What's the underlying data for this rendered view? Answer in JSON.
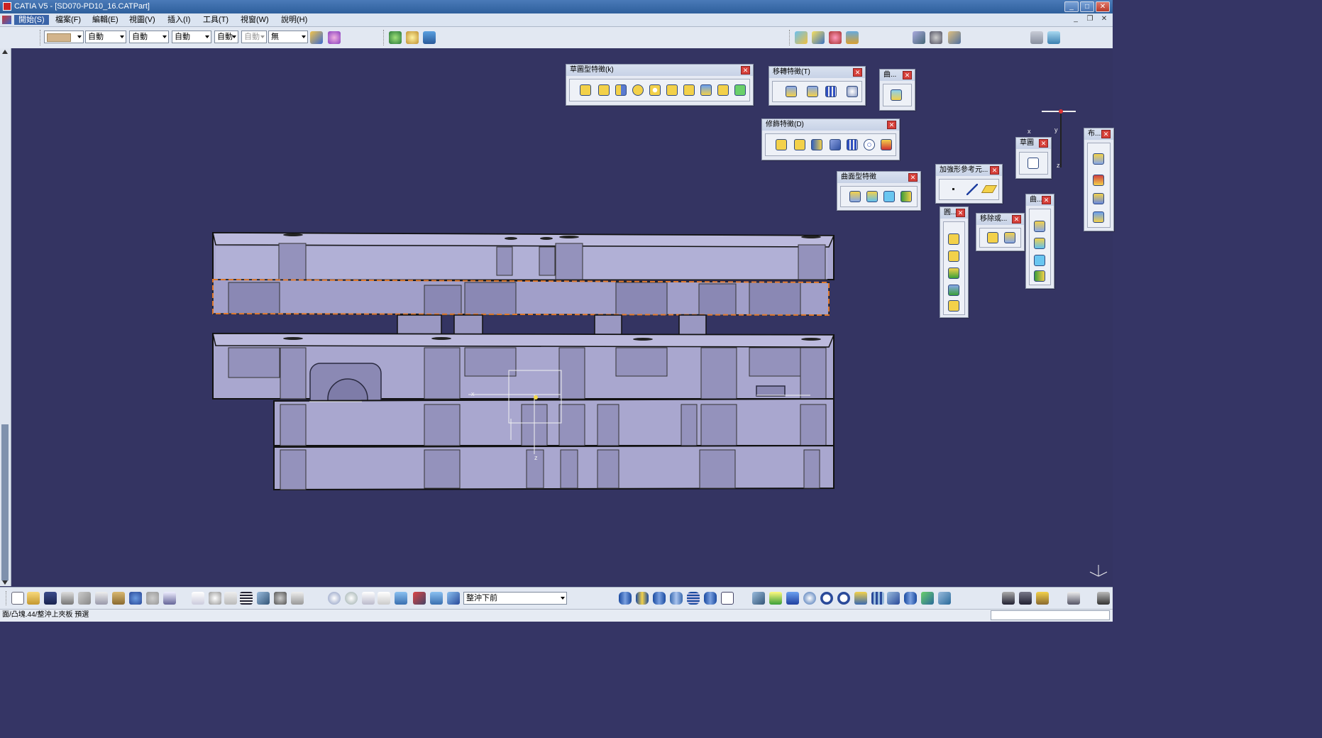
{
  "window": {
    "title": "CATIA V5 - [SD070-PD10_16.CATPart]",
    "buttons": [
      "_",
      "□",
      "✕"
    ]
  },
  "menubar": {
    "items": [
      "開始(S)",
      "檔案(F)",
      "編輯(E)",
      "視圖(V)",
      "插入(I)",
      "工具(T)",
      "視窗(W)",
      "說明(H)"
    ],
    "active": "開始(S)"
  },
  "top_toolbar": {
    "color_swatch": "#d2b48c",
    "combos": [
      "自動",
      "自動",
      "自動",
      "自動",
      "自動",
      "無"
    ]
  },
  "floating_toolbars": [
    {
      "title": "草圖型特徵(k)"
    },
    {
      "title": "修飾特徵(D)"
    },
    {
      "title": "移轉特徵(T)"
    },
    {
      "title": "曲..."
    },
    {
      "title": "曲面型特徵"
    },
    {
      "title": "加強形參考元..."
    },
    {
      "title": "草圖"
    },
    {
      "title": "布..."
    },
    {
      "title": "圓..."
    },
    {
      "title": "移除或..."
    },
    {
      "title": "曲..."
    }
  ],
  "viewport": {
    "background": "#343462",
    "part_fill": "#a8a6cc",
    "selection_color": "#e0782a",
    "axis_labels": {
      "x": "x",
      "z": "z",
      "y": "y"
    }
  },
  "bottom_toolbar": {
    "view_combo": "整沖下前"
  },
  "status_bar": {
    "text": "面/凸塊.44/整沖上夾板 預選"
  }
}
